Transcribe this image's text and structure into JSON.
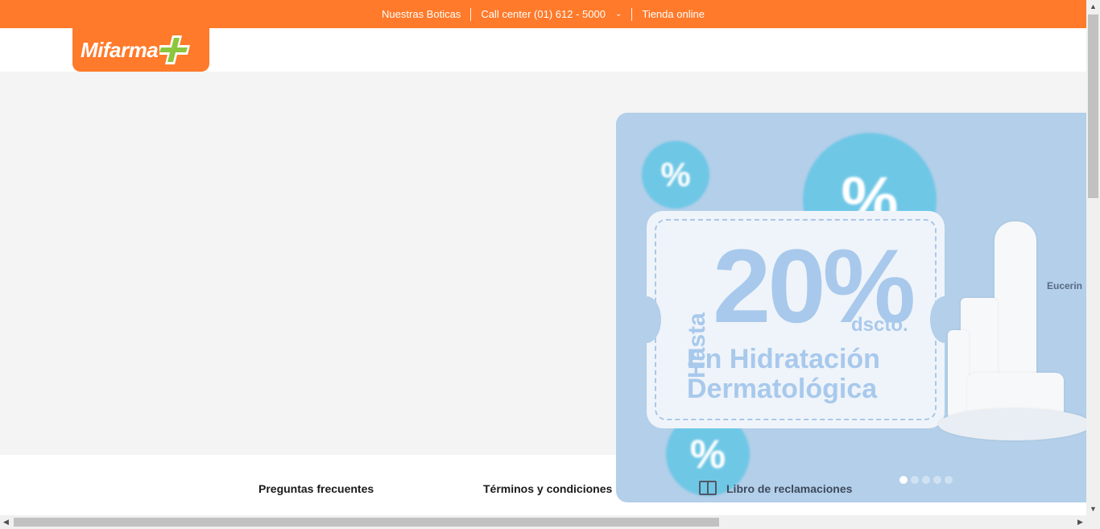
{
  "topbar": {
    "links": [
      "Nuestras Boticas",
      "Call center (01) 612 - 5000",
      "Tienda online"
    ],
    "call_chevron": "⌄"
  },
  "header": {
    "logo_text": "Mifarma"
  },
  "banner": {
    "hasta": "Hasta",
    "big": "20%",
    "dscto": "dscto.",
    "line1": "En Hidratación",
    "line2": "Dermatológica",
    "brand": "Eucerin",
    "dots_count": 5,
    "active_dot": 0
  },
  "footer": {
    "faq": "Preguntas frecuentes",
    "terms": "Términos y condiciones",
    "complaints": "Libro de reclamaciones"
  },
  "colors": {
    "brand_orange": "#ff7a2a",
    "banner_bg": "#b3cfe9"
  }
}
